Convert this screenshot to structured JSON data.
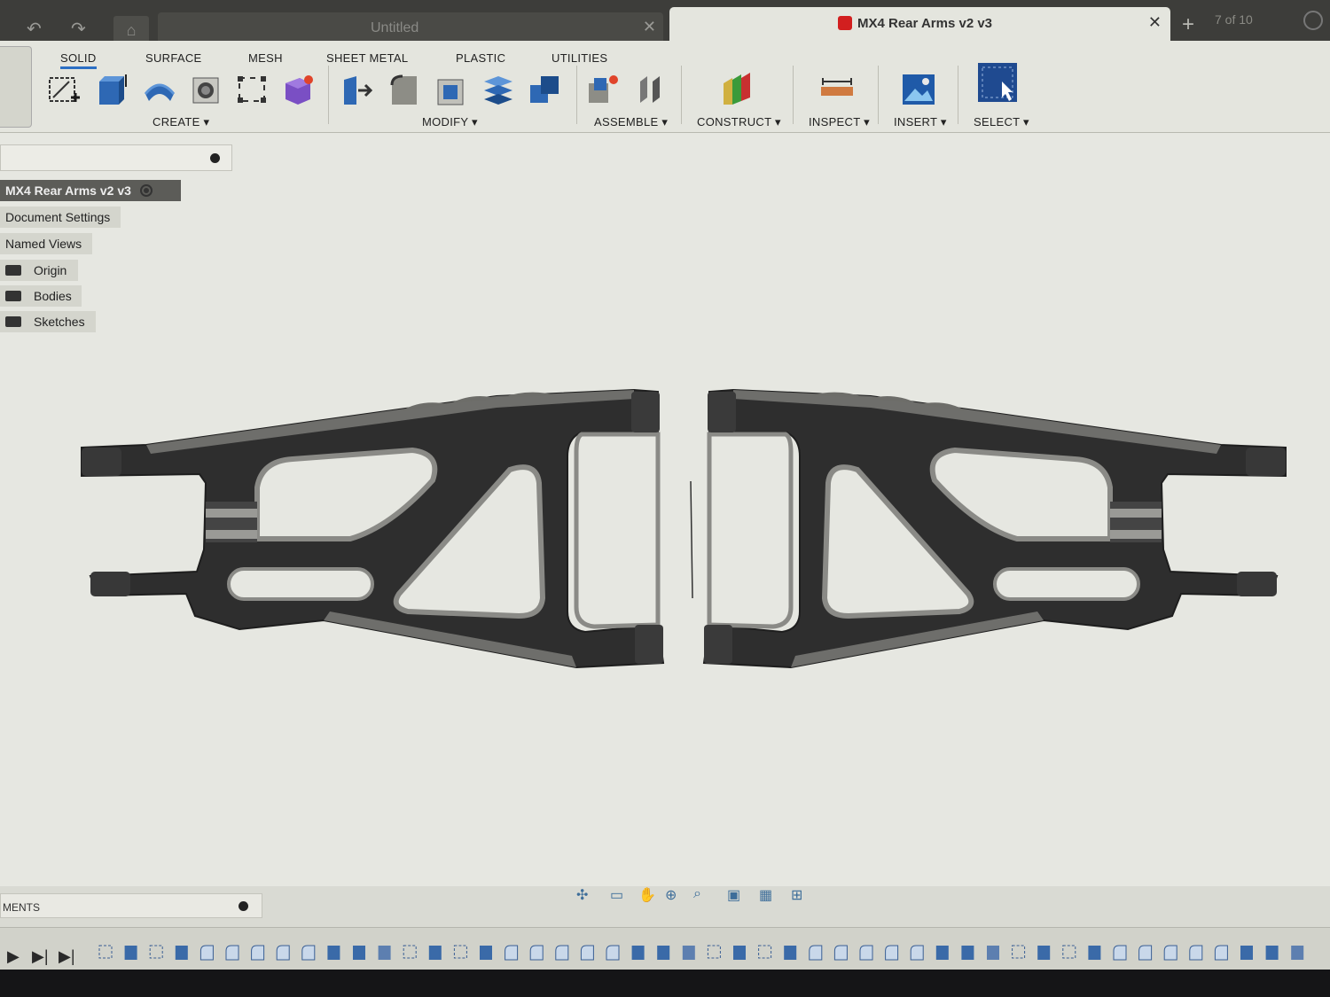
{
  "tabs": {
    "inactive_label": "Untitled",
    "active_label": "MX4 Rear Arms v2 v3",
    "job_status": "7 of 10",
    "new_tab": "+",
    "close_glyph": "✕"
  },
  "ribbon": {
    "workspace_tabs": [
      "SOLID",
      "SURFACE",
      "MESH",
      "SHEET METAL",
      "PLASTIC",
      "UTILITIES"
    ],
    "active_tab": "SOLID",
    "groups": {
      "create": "CREATE ▾",
      "modify": "MODIFY ▾",
      "assemble": "ASSEMBLE ▾",
      "construct": "CONSTRUCT ▾",
      "inspect": "INSPECT ▾",
      "insert": "INSERT ▾",
      "select": "SELECT ▾"
    }
  },
  "browser": {
    "root": "MX4 Rear Arms v2 v3",
    "items": [
      "Document Settings",
      "Named Views",
      "Origin",
      "Bodies",
      "Sketches"
    ]
  },
  "comments": {
    "label": "MENTS"
  },
  "colors": {
    "part_fill": "#2e2e2e",
    "part_bevel": "#8a8a86",
    "canvas_bg": "#e6e7e1",
    "accent_blue": "#2c6fc4",
    "tab_active_icon": "#d21f1f"
  }
}
